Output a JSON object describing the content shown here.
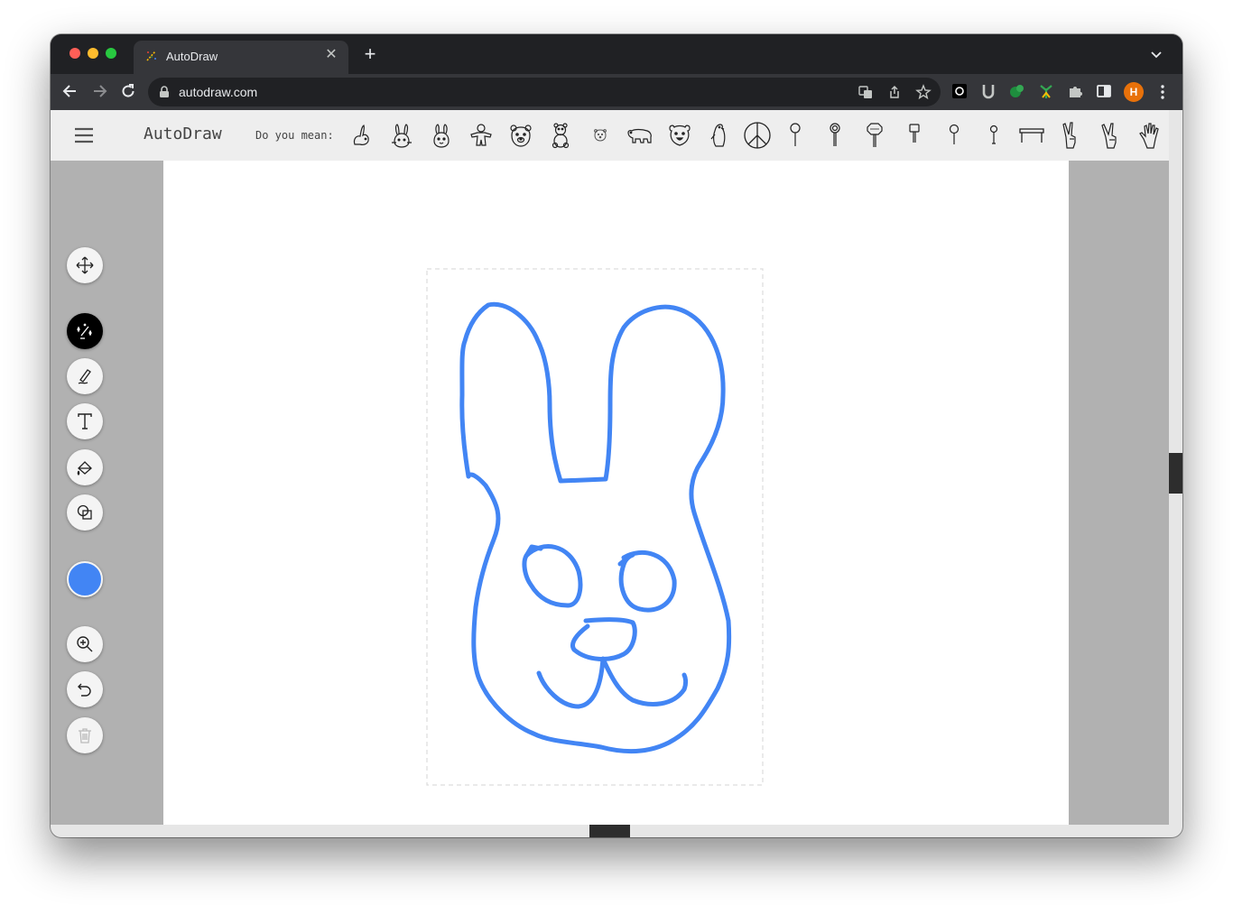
{
  "browser": {
    "tab_title": "AutoDraw",
    "url": "autodraw.com",
    "profile_initial": "H"
  },
  "app": {
    "title": "AutoDraw",
    "suggestion_label": "Do you mean:",
    "suggestions": [
      "rabbit-icon",
      "bunny-face-icon",
      "bunny-face-icon",
      "gingerbread-icon",
      "bear-face-icon",
      "teddy-bear-icon",
      "polar-bear-icon",
      "bear-icon",
      "bear-head-icon",
      "penguin-icon",
      "peace-sign-icon",
      "lollipop-icon",
      "lollipop-icon",
      "stop-sign-icon",
      "sign-post-icon",
      "balloon-icon",
      "balloon-icon",
      "table-icon",
      "peace-hand-icon",
      "peace-hand-icon",
      "hand-icon"
    ],
    "tools": [
      "move-icon",
      "autodraw-icon",
      "draw-icon",
      "type-icon",
      "fill-icon",
      "shape-icon",
      "color",
      "zoom-icon",
      "undo-icon",
      "delete-icon"
    ],
    "active_tool": "autodraw",
    "current_color": "#4285f4"
  }
}
